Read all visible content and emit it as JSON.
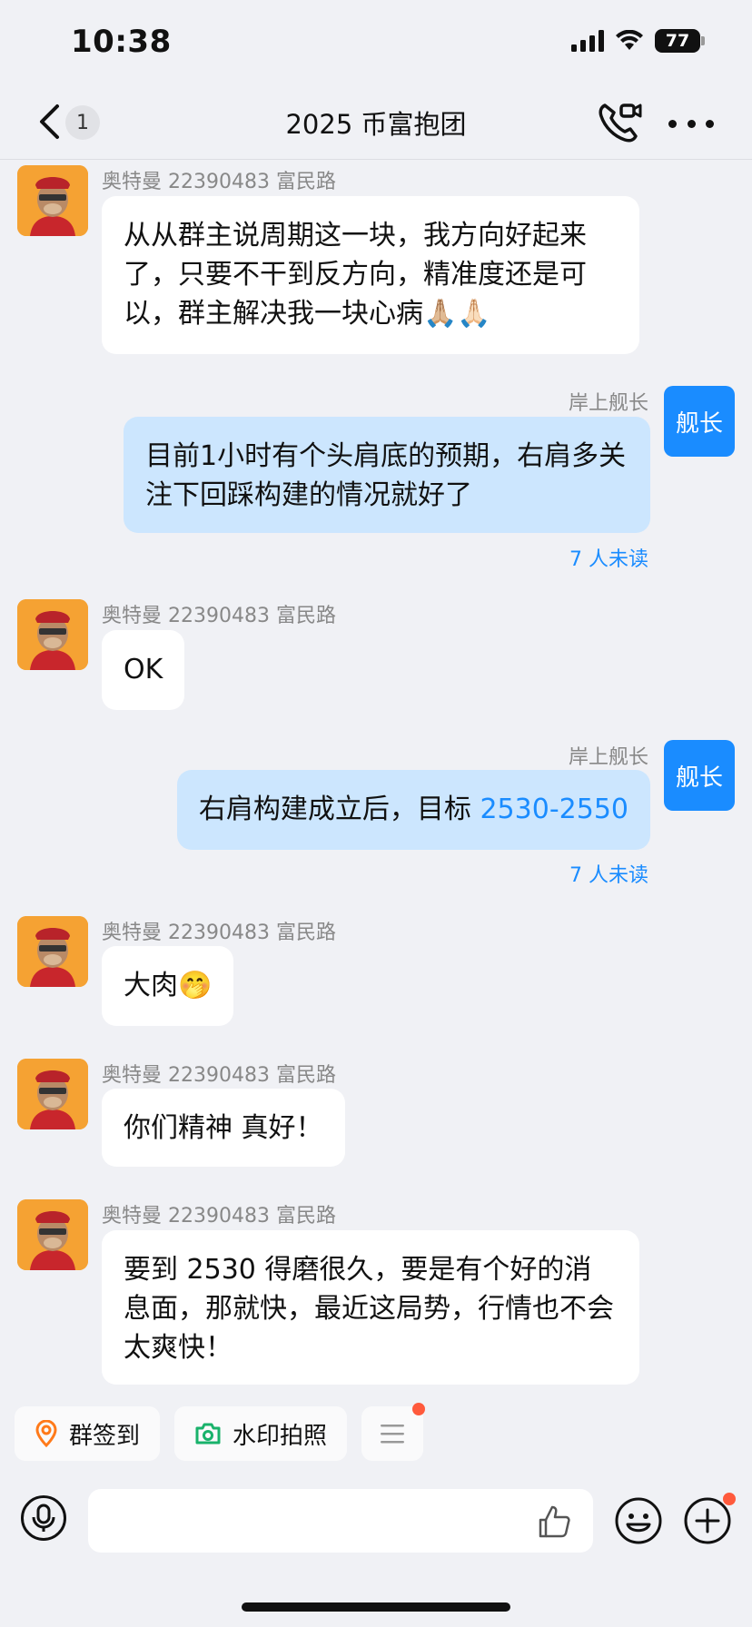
{
  "status_bar": {
    "time": "10:38",
    "battery": "77"
  },
  "nav": {
    "back_count": "1",
    "title": "2025 币富抱团"
  },
  "messages": [
    {
      "side": "in",
      "sender": "奥特曼 22390483 富民路",
      "text": "从从群主说周期这一块，我方向好起来了，只要不干到反方向，精准度还是可以，群主解决我一块心病🙏🏼🙏🏻"
    },
    {
      "side": "out",
      "sender": "岸上舰长",
      "avatar_text": "舰长",
      "text": "目前1小时有个头肩底的预期，右肩多关注下回踩构建的情况就好了",
      "read_status": "7 人未读"
    },
    {
      "side": "in",
      "sender": "奥特曼 22390483 富民路",
      "text": "OK"
    },
    {
      "side": "out",
      "sender": "岸上舰长",
      "avatar_text": "舰长",
      "text_prefix": "右肩构建成立后，目标 ",
      "text_highlight": "2530-2550",
      "read_status": "7 人未读"
    },
    {
      "side": "in",
      "sender": "奥特曼 22390483 富民路",
      "text": "大肉🤭"
    },
    {
      "side": "in",
      "sender": "奥特曼 22390483 富民路",
      "text": "你们精神 真好！"
    },
    {
      "side": "in",
      "sender": "奥特曼 22390483 富民路",
      "text": "要到 2530 得磨很久，要是有个好的消息面，那就快，最近这局势，行情也不会太爽快！"
    }
  ],
  "quick_actions": [
    {
      "label": "群签到",
      "icon": "location-pin-icon"
    },
    {
      "label": "水印拍照",
      "icon": "camera-icon"
    },
    {
      "label": "",
      "icon": "menu-lines-icon"
    }
  ],
  "colors": {
    "accent": "#1a8cff",
    "outgoing_bubble": "#cce6fe",
    "background": "#f0f1f5"
  }
}
